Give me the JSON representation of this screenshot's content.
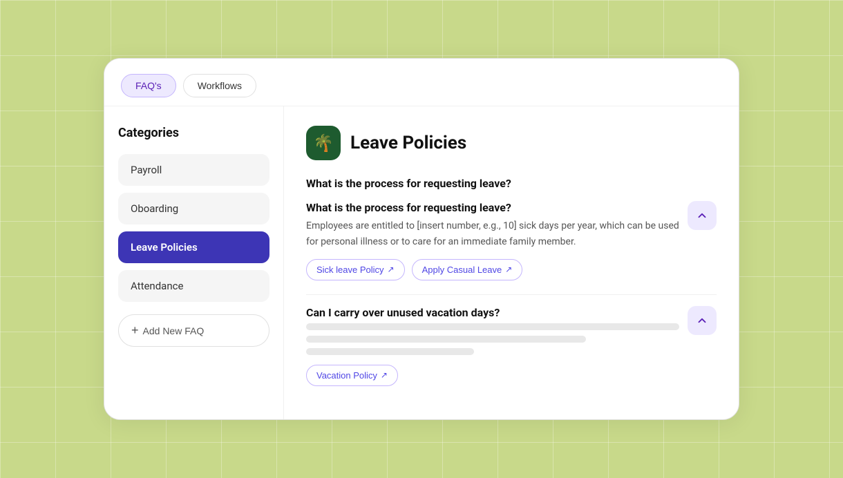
{
  "tabs": [
    {
      "id": "faqs",
      "label": "FAQ's",
      "active": true
    },
    {
      "id": "workflows",
      "label": "Workflows",
      "active": false
    }
  ],
  "sidebar": {
    "title": "Categories",
    "items": [
      {
        "id": "payroll",
        "label": "Payroll",
        "active": false
      },
      {
        "id": "onboarding",
        "label": "Oboarding",
        "active": false
      },
      {
        "id": "leave-policies",
        "label": "Leave Policies",
        "active": true
      },
      {
        "id": "attendance",
        "label": "Attendance",
        "active": false
      }
    ],
    "add_button_label": "Add New FAQ"
  },
  "content": {
    "category_icon": "🌴",
    "category_title": "Leave Policies",
    "faq_section_label": "What is the process for requesting leave?",
    "faqs": [
      {
        "id": "faq1",
        "question": "What is the process for requesting leave?",
        "answer": "Employees are entitled to [insert number, e.g., 10] sick days per year, which can be used for personal illness or to care for an immediate family member.",
        "tags": [
          {
            "id": "sick-leave",
            "label": "Sick leave Policy"
          },
          {
            "id": "casual-leave",
            "label": "Apply Casual Leave"
          }
        ],
        "expanded": true
      },
      {
        "id": "faq2",
        "question": "Can I carry over unused vacation days?",
        "answer": "",
        "tags": [
          {
            "id": "vacation-policy",
            "label": "Vacation Policy"
          }
        ],
        "expanded": true
      }
    ]
  }
}
